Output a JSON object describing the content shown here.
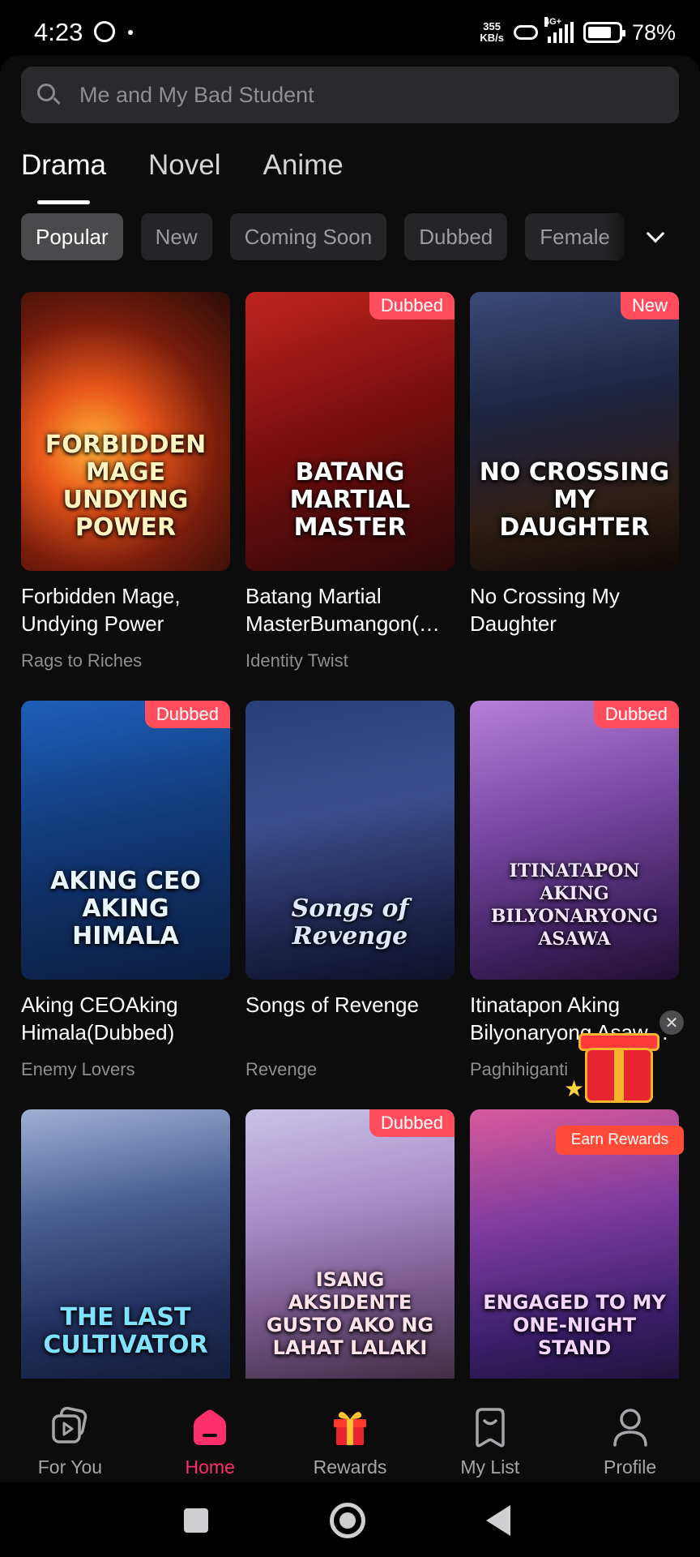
{
  "status_bar": {
    "time": "4:23",
    "net_speed_value": "355",
    "net_speed_unit": "KB/s",
    "network": "4G+",
    "battery": "78%"
  },
  "search": {
    "placeholder": "Me and My Bad Student"
  },
  "tabs": [
    "Drama",
    "Novel",
    "Anime"
  ],
  "active_tab": "Drama",
  "chips": [
    "Popular",
    "New",
    "Coming Soon",
    "Dubbed",
    "Female"
  ],
  "active_chip": "Popular",
  "cards": [
    {
      "title": "Forbidden Mage, Undying Power",
      "genre": "Rags to Riches",
      "badge": "",
      "poster_text": "Forbidden Mage Undying Power"
    },
    {
      "title": "Batang Martial MasterBumangon(…",
      "genre": "Identity Twist",
      "badge": "Dubbed",
      "poster_text": "Batang Martial Master"
    },
    {
      "title": "No Crossing My Daughter",
      "genre": "",
      "badge": "New",
      "poster_text": "No Crossing My Daughter"
    },
    {
      "title": "Aking CEOAking Himala(Dubbed)",
      "genre": "Enemy Lovers",
      "badge": "Dubbed",
      "poster_text": "Aking CEO Aking Himala"
    },
    {
      "title": "Songs of Revenge",
      "genre": "Revenge",
      "badge": "",
      "poster_text": "Songs of Revenge"
    },
    {
      "title": "Itinatapon Aking Bilyonaryong Asaw…",
      "genre": "Paghihiganti",
      "badge": "Dubbed",
      "poster_text": "Itinatapon Aking Bilyonaryong Asawa"
    },
    {
      "title": "",
      "genre": "",
      "badge": "",
      "poster_text": "The Last Cultivator"
    },
    {
      "title": "",
      "genre": "",
      "badge": "Dubbed",
      "poster_text": "Isang Aksidente Gusto Ako ng Lahat Lalaki"
    },
    {
      "title": "",
      "genre": "",
      "badge": "",
      "poster_text": "Engaged to My One-Night Stand"
    }
  ],
  "rewards_popup": {
    "label": "Earn Rewards",
    "close": "✕"
  },
  "bottom_nav": [
    {
      "label": "For You",
      "icon": "video-stack-icon"
    },
    {
      "label": "Home",
      "icon": "home-icon"
    },
    {
      "label": "Rewards",
      "icon": "gift-icon"
    },
    {
      "label": "My List",
      "icon": "bookmark-icon"
    },
    {
      "label": "Profile",
      "icon": "person-icon"
    }
  ],
  "active_nav": "Home",
  "colors": {
    "accent": "#ff2f6d",
    "badge": "#ff4d5e",
    "background": "#0c0c0d",
    "chip": "#252527"
  }
}
